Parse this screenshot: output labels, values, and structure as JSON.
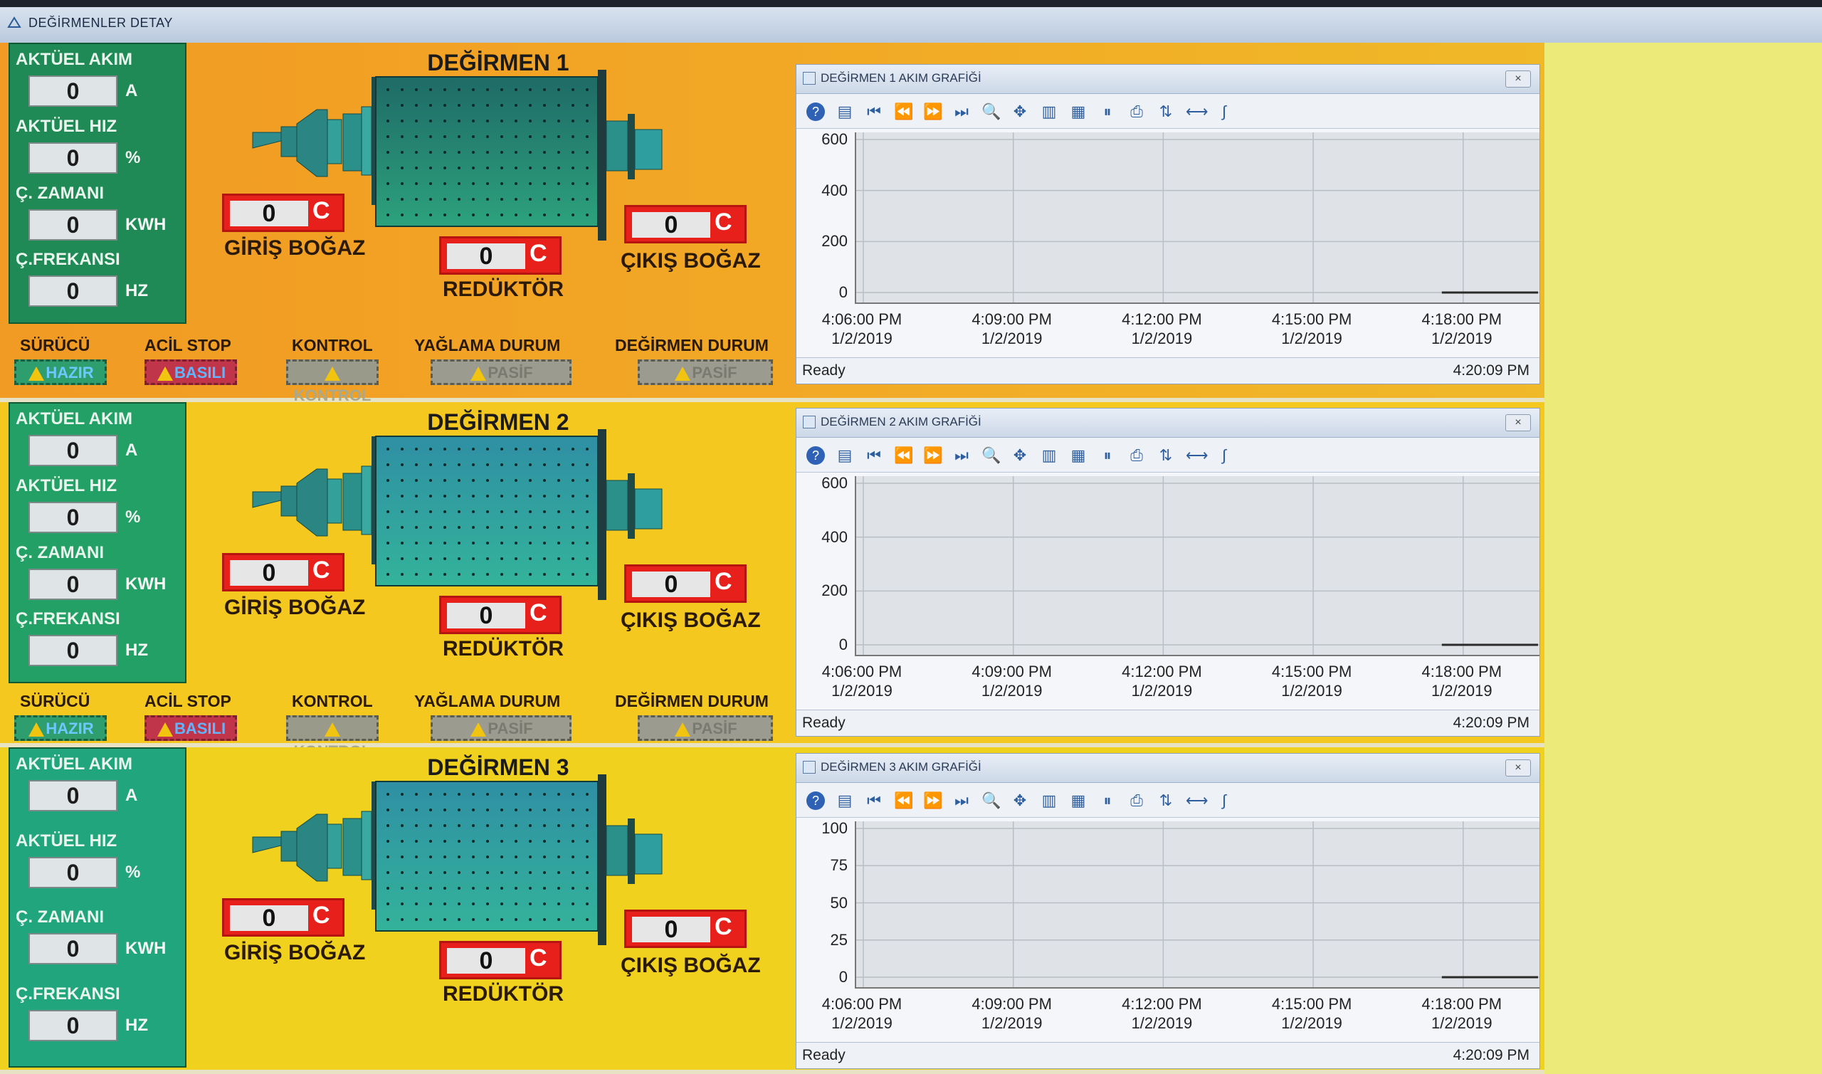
{
  "window": {
    "title": "DEĞİRMENLER DETAY"
  },
  "labels": {
    "current": "AKTÜEL AKIM",
    "speed": "AKTÜEL HIZ",
    "work_time": "Ç. ZAMANI",
    "frequency": "Ç.FREKANSI",
    "unit_current": "A",
    "unit_speed": "%",
    "unit_time": "KWH",
    "unit_freq": "HZ",
    "inlet": "GİRİŞ BOĞAZ",
    "reducer": "REDÜKTÖR",
    "outlet": "ÇIKIŞ BOĞAZ",
    "temp_unit": "C",
    "driver": "SÜRÜCÜ",
    "estop": "ACİL STOP",
    "control": "KONTROL",
    "lube": "YAĞLAMA  DURUM",
    "mill_status": "DEĞİRMEN  DURUM"
  },
  "status_values": {
    "driver": "HAZIR",
    "estop": "BASILI",
    "control": "KONTROL",
    "lube": "PASİF",
    "mill": "PASİF"
  },
  "mills": [
    {
      "title": "DEĞİRMEN 1",
      "current": "0",
      "speed": "0",
      "work_time": "0",
      "frequency": "0",
      "inlet_temp": "0",
      "reducer_temp": "0",
      "outlet_temp": "0",
      "chart": {
        "title": "DEĞİRMEN 1 AKIM GRAFİĞİ",
        "status": "Ready",
        "time": "4:20:09 PM"
      }
    },
    {
      "title": "DEĞİRMEN 2",
      "current": "0",
      "speed": "0",
      "work_time": "0",
      "frequency": "0",
      "inlet_temp": "0",
      "reducer_temp": "0",
      "outlet_temp": "0",
      "chart": {
        "title": "DEĞİRMEN 2 AKIM GRAFİĞİ",
        "status": "Ready",
        "time": "4:20:09 PM"
      }
    },
    {
      "title": "DEĞİRMEN 3",
      "current": "0",
      "speed": "0",
      "work_time": "0",
      "frequency": "0",
      "inlet_temp": "0",
      "reducer_temp": "0",
      "outlet_temp": "0",
      "chart": {
        "title": "DEĞİRMEN 3 AKIM GRAFİĞİ",
        "status": "Ready",
        "time": "4:20:09 PM"
      }
    }
  ],
  "toolbar_icons": [
    "help-icon",
    "properties-icon",
    "first-icon",
    "back-icon",
    "forward-icon",
    "last-icon",
    "zoom-icon",
    "pan-icon",
    "axis-icon",
    "grid-icon",
    "pause-icon",
    "print-icon",
    "export-icon",
    "fit-icon",
    "cursor-icon"
  ],
  "colors": {
    "alarm_red": "#e8201b",
    "mill_teal": "#2aa29a",
    "panel_orange": "#f19a24",
    "panel_yellow": "#f4c81f",
    "green_box": "#1f8a55"
  },
  "chart_data": [
    {
      "type": "line",
      "title": "DEĞİRMEN 1 AKIM GRAFİĞİ",
      "ylim": [
        0,
        600
      ],
      "yticks": [
        "600",
        "400",
        "200",
        "0"
      ],
      "x_tick_labels": [
        [
          "4:06:00 PM",
          "1/2/2019"
        ],
        [
          "4:09:00 PM",
          "1/2/2019"
        ],
        [
          "4:12:00 PM",
          "1/2/2019"
        ],
        [
          "4:15:00 PM",
          "1/2/2019"
        ],
        [
          "4:18:00 PM",
          "1/2/2019"
        ]
      ],
      "series": [
        {
          "x": [
            "4:18:00 PM",
            "4:20:09 PM"
          ],
          "values": [
            0,
            0
          ]
        }
      ]
    },
    {
      "type": "line",
      "title": "DEĞİRMEN 2 AKIM GRAFİĞİ",
      "ylim": [
        0,
        600
      ],
      "yticks": [
        "600",
        "400",
        "200",
        "0"
      ],
      "x_tick_labels": [
        [
          "4:06:00 PM",
          "1/2/2019"
        ],
        [
          "4:09:00 PM",
          "1/2/2019"
        ],
        [
          "4:12:00 PM",
          "1/2/2019"
        ],
        [
          "4:15:00 PM",
          "1/2/2019"
        ],
        [
          "4:18:00 PM",
          "1/2/2019"
        ]
      ],
      "series": [
        {
          "x": [
            "4:18:00 PM",
            "4:20:09 PM"
          ],
          "values": [
            0,
            0
          ]
        }
      ]
    },
    {
      "type": "line",
      "title": "DEĞİRMEN 3 AKIM GRAFİĞİ",
      "ylim": [
        0,
        100
      ],
      "yticks": [
        "100",
        "75",
        "50",
        "25",
        "0"
      ],
      "x_tick_labels": [
        [
          "4:06:00 PM",
          "1/2/2019"
        ],
        [
          "4:09:00 PM",
          "1/2/2019"
        ],
        [
          "4:12:00 PM",
          "1/2/2019"
        ],
        [
          "4:15:00 PM",
          "1/2/2019"
        ],
        [
          "4:18:00 PM",
          "1/2/2019"
        ]
      ],
      "series": [
        {
          "x": [
            "4:18:00 PM",
            "4:20:09 PM"
          ],
          "values": [
            0,
            0
          ]
        }
      ]
    }
  ]
}
